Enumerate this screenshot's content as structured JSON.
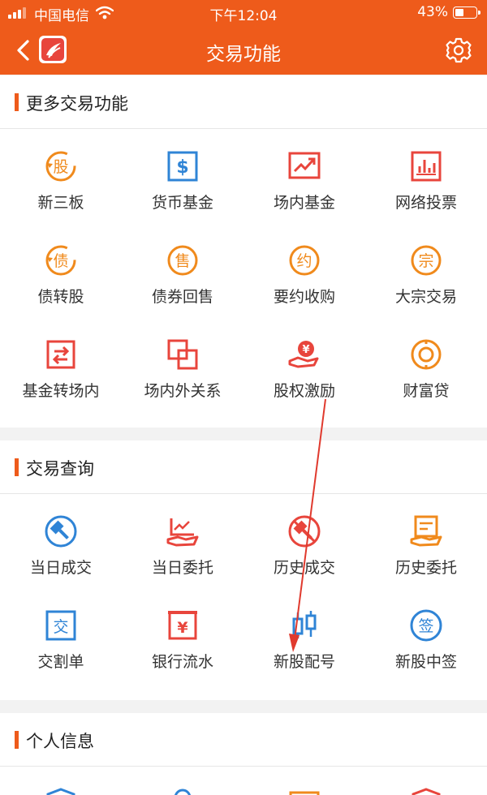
{
  "status_bar": {
    "carrier": "中国电信",
    "time": "下午12:04",
    "battery": "43%",
    "battery_level": 0.43
  },
  "nav": {
    "title": "交易功能"
  },
  "colors": {
    "brand": "#ee5b1b",
    "orange_icon": "#f08a1c",
    "red_icon": "#e8453c",
    "blue_icon": "#2f84d6"
  },
  "sections": [
    {
      "title": "更多交易功能",
      "items": [
        {
          "label": "新三板",
          "icon": "gu-circle-icon"
        },
        {
          "label": "货币基金",
          "icon": "dollar-box-icon"
        },
        {
          "label": "场内基金",
          "icon": "trend-chart-icon"
        },
        {
          "label": "网络投票",
          "icon": "bar-chart-icon"
        },
        {
          "label": "债转股",
          "icon": "zhai-circle-icon"
        },
        {
          "label": "债券回售",
          "icon": "shou-circle-icon"
        },
        {
          "label": "要约收购",
          "icon": "yue-circle-icon"
        },
        {
          "label": "大宗交易",
          "icon": "zong-circle-icon"
        },
        {
          "label": "基金转场内",
          "icon": "transfer-box-icon"
        },
        {
          "label": "场内外关系",
          "icon": "overlap-squares-icon"
        },
        {
          "label": "股权激励",
          "icon": "yen-hand-icon"
        },
        {
          "label": "财富贷",
          "icon": "coin-icon"
        }
      ]
    },
    {
      "title": "交易查询",
      "items": [
        {
          "label": "当日成交",
          "icon": "gavel-circle-icon"
        },
        {
          "label": "当日委托",
          "icon": "chart-hand-icon"
        },
        {
          "label": "历史成交",
          "icon": "gavel-strike-icon"
        },
        {
          "label": "历史委托",
          "icon": "document-hand-icon"
        },
        {
          "label": "交割单",
          "icon": "jiao-box-icon"
        },
        {
          "label": "银行流水",
          "icon": "yen-doc-icon"
        },
        {
          "label": "新股配号",
          "icon": "candlestick-icon"
        },
        {
          "label": "新股中签",
          "icon": "qian-circle-icon"
        }
      ]
    },
    {
      "title": "个人信息",
      "items": []
    }
  ]
}
